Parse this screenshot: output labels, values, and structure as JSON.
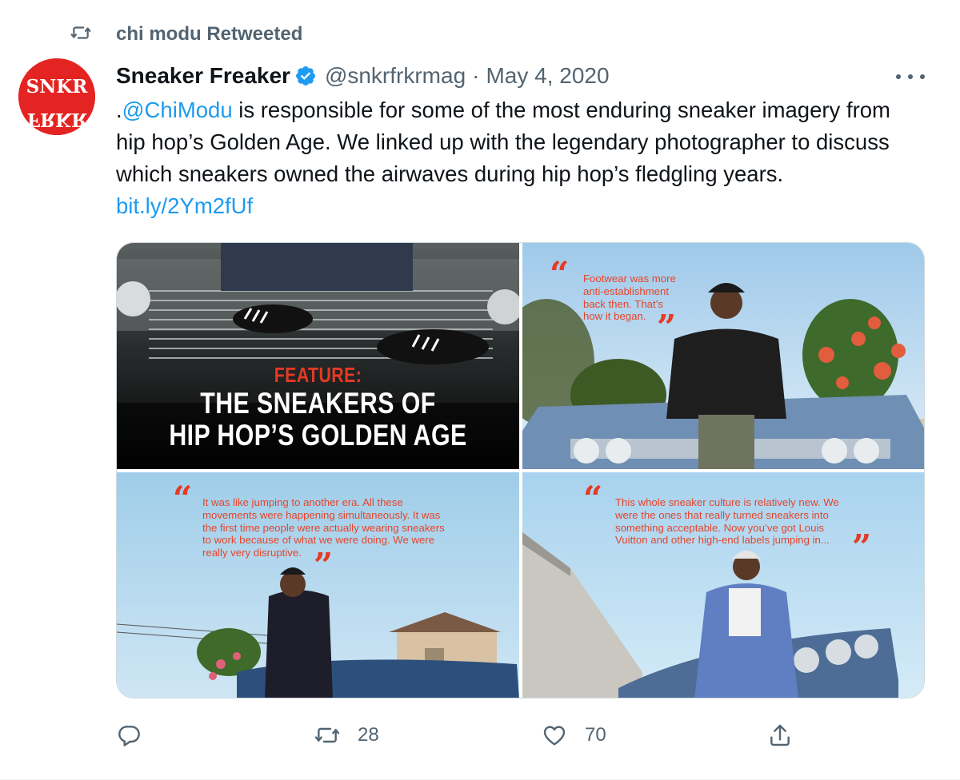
{
  "retweet_context": {
    "text": "chi modu Retweeted",
    "icon": "retweet-icon"
  },
  "author": {
    "display_name": "Sneaker Freaker",
    "handle": "@snkrfrkrmag",
    "separator": "·",
    "date": "May 4, 2020",
    "avatar_text_top": "SNKR",
    "avatar_text_bottom": "FRKR",
    "verified_icon": "verified-badge-icon"
  },
  "tweet": {
    "text_prefix": ".",
    "mention": "@ChiModu",
    "text_body": " is responsible for some of the most enduring sneaker imagery from hip hop’s Golden Age. We linked up with the legendary photographer to discuss which sneakers owned the airwaves during hip hop’s fledgling years. ",
    "link": "bit.ly/2Ym2fUf"
  },
  "media": {
    "image1": {
      "label": "FEATURE:",
      "title_line1": "THE SNEAKERS OF",
      "title_line2": "HIP HOP’S GOLDEN AGE"
    },
    "image2": {
      "quote_lines": [
        "Footwear was more",
        "anti-establishment",
        "back then. That’s",
        "how it began."
      ]
    },
    "image3": {
      "quote_lines": [
        "It was like jumping to another era. All these",
        "movements were happening simultaneously. It was",
        "the first time people were actually wearing sneakers",
        "to work because of what we were doing. We were",
        "really very disruptive."
      ]
    },
    "image4": {
      "quote_lines": [
        "This whole sneaker culture is relatively new. We",
        "were the ones that really turned sneakers into",
        "something acceptable. Now you’ve got Louis",
        "Vuitton and other high-end labels jumping in..."
      ]
    },
    "open_quote": "“",
    "close_quote": "”"
  },
  "actions": {
    "reply": {
      "icon": "reply-icon",
      "count": ""
    },
    "retweet": {
      "icon": "retweet-icon",
      "count": "28"
    },
    "like": {
      "icon": "heart-icon",
      "count": "70"
    },
    "share": {
      "icon": "share-icon"
    }
  },
  "colors": {
    "link": "#1d9bf0",
    "secondary_text": "#536471",
    "brand_red": "#e42422",
    "quote_red": "#e5452b"
  }
}
